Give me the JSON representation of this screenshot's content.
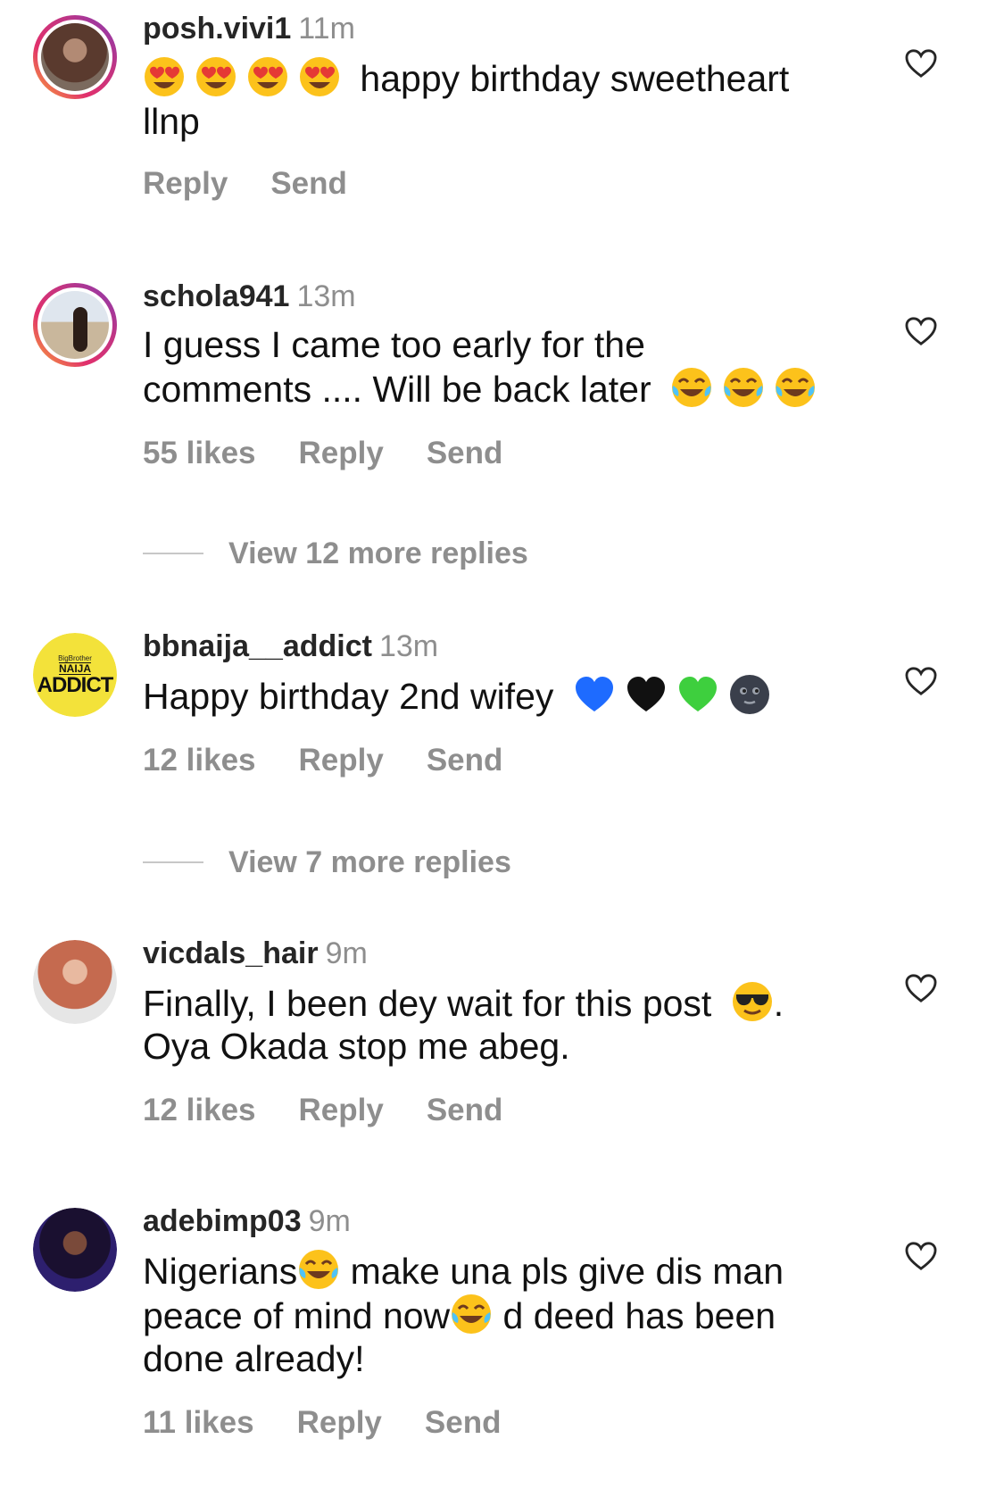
{
  "comments": [
    {
      "username": "posh.vivi1",
      "time": "11m",
      "text_after_emoji": "happy birthday sweetheart",
      "text_line2": "llnp",
      "emoji_prefix": [
        "heart-eyes-emoji",
        "heart-eyes-emoji",
        "heart-eyes-emoji",
        "heart-eyes-emoji"
      ],
      "likes": "",
      "reply": "Reply",
      "send": "Send"
    },
    {
      "username": "schola941",
      "time": "13m",
      "text_line1": "I guess I came too early for the",
      "text_line2": "comments .... Will be back later",
      "emoji_suffix": [
        "tears-of-joy-emoji",
        "tears-of-joy-emoji",
        "tears-of-joy-emoji"
      ],
      "likes": "55 likes",
      "reply": "Reply",
      "send": "Send",
      "more_replies": "View 12 more replies"
    },
    {
      "username": "bbnaija__addict",
      "time": "13m",
      "text_line1": "Happy birthday 2nd wifey",
      "emoji_suffix": [
        "blue-heart-emoji",
        "black-heart-emoji",
        "green-heart-emoji",
        "new-moon-face-emoji"
      ],
      "avatar_text_small": "BigBrother",
      "avatar_text_mid": "NAIJA",
      "avatar_text_big": "ADDICT",
      "likes": "12 likes",
      "reply": "Reply",
      "send": "Send",
      "more_replies": "View 7 more replies"
    },
    {
      "username": "vicdals_hair",
      "time": "9m",
      "text_line1": "Finally, I been dey wait for this post",
      "text_line1_end": ".",
      "text_line2": "Oya Okada stop me abeg.",
      "likes": "12 likes",
      "reply": "Reply",
      "send": "Send"
    },
    {
      "username": "adebimp03",
      "time": "9m",
      "text_line1a": "Nigerians",
      "text_line1b": " make una pls give dis man",
      "text_line2a": "peace of mind now",
      "text_line2b": " d deed has been",
      "text_line3": "done already!",
      "likes": "11 likes",
      "reply": "Reply",
      "send": "Send"
    }
  ],
  "colors": {
    "meta": "#8e8e8e",
    "text": "#111111",
    "username": "#262626",
    "ring_start": "#f9b035",
    "ring_end": "#c13584"
  }
}
